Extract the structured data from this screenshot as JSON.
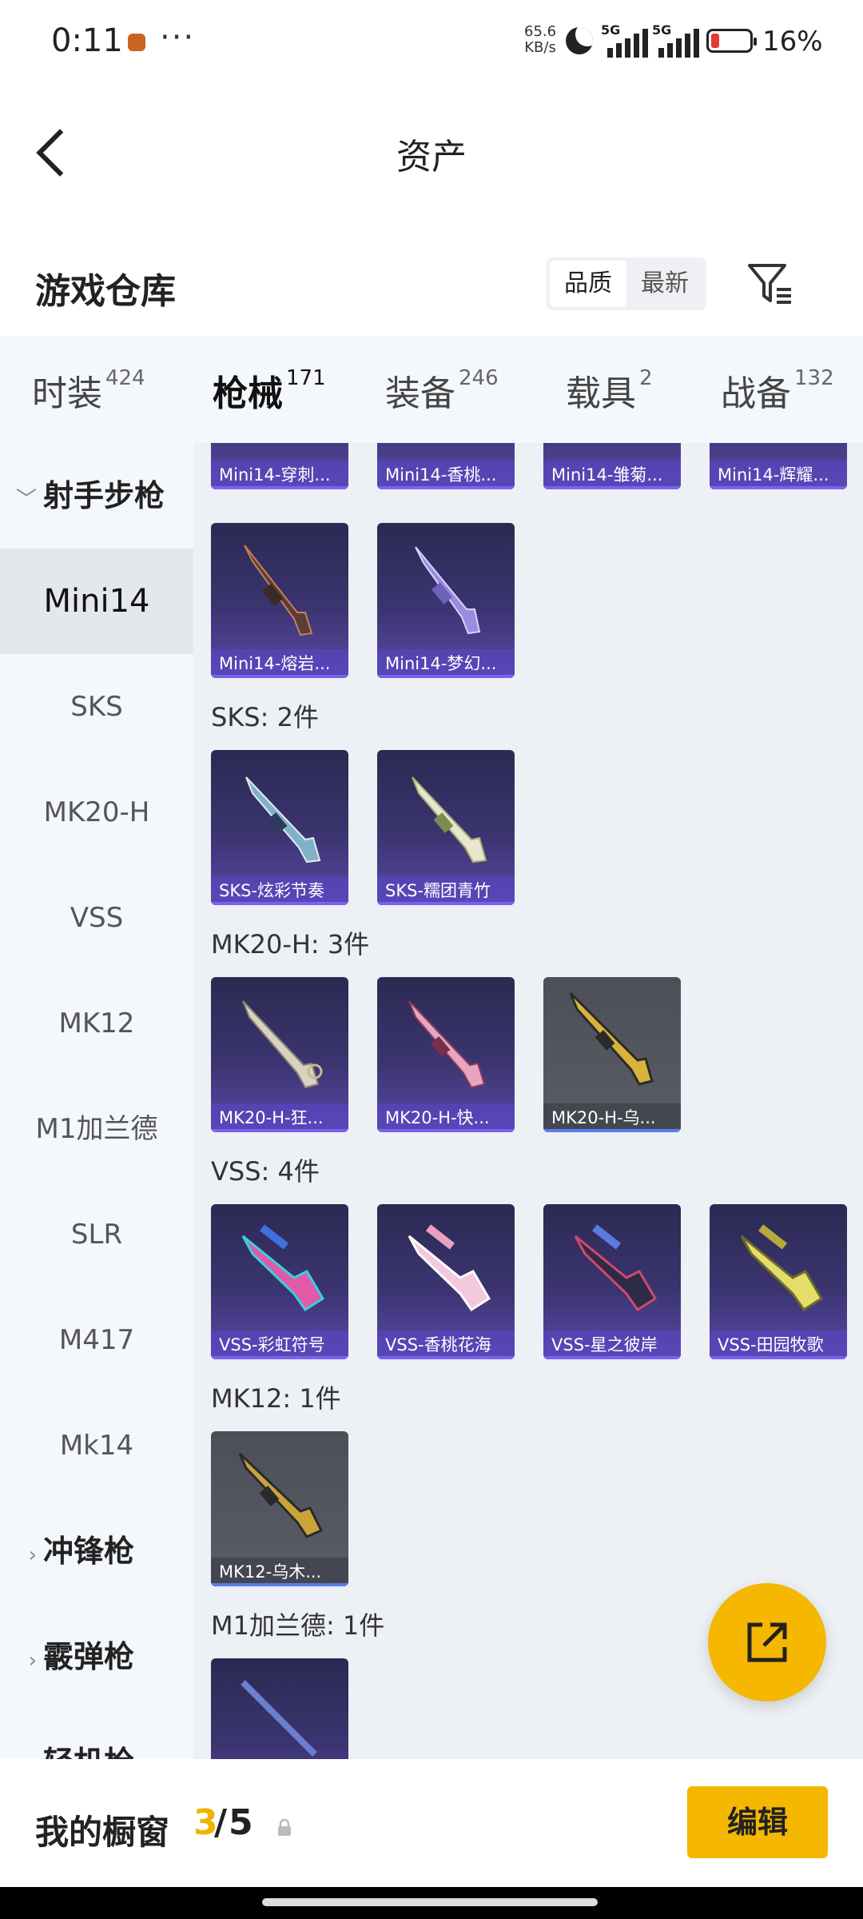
{
  "status": {
    "time": "0:11",
    "net_speed": "65.6",
    "net_unit": "KB/s",
    "sim1": "5G",
    "sim2": "5G",
    "battery": "16%"
  },
  "header": {
    "title": "资产"
  },
  "warehouse": {
    "title": "游戏仓库",
    "sort_quality": "品质",
    "sort_latest": "最新"
  },
  "tabs": [
    {
      "name": "时装",
      "count": "424"
    },
    {
      "name": "枪械",
      "count": "171"
    },
    {
      "name": "装备",
      "count": "246"
    },
    {
      "name": "载具",
      "count": "2"
    },
    {
      "name": "战备",
      "count": "132"
    }
  ],
  "sidebar": {
    "group_open": "射手步枪",
    "items": [
      "Mini14",
      "SKS",
      "MK20-H",
      "VSS",
      "MK12",
      "M1加兰德",
      "SLR",
      "M417",
      "Mk14"
    ],
    "group2": "冲锋枪",
    "group3": "霰弹枪",
    "group4": "轻机枪"
  },
  "sections": {
    "mini14_row1": [
      "Mini14-穿刺...",
      "Mini14-香桃...",
      "Mini14-雏菊...",
      "Mini14-辉耀..."
    ],
    "mini14_row2": [
      "Mini14-熔岩...",
      "Mini14-梦幻..."
    ],
    "sks_title": "SKS: 2件",
    "sks": [
      "SKS-炫彩节奏",
      "SKS-糯团青竹"
    ],
    "mk20_title": "MK20-H: 3件",
    "mk20": [
      "MK20-H-狂...",
      "MK20-H-快...",
      "MK20-H-乌..."
    ],
    "vss_title": "VSS: 4件",
    "vss": [
      "VSS-彩虹符号",
      "VSS-香桃花海",
      "VSS-星之彼岸",
      "VSS-田园牧歌"
    ],
    "mk12_title": "MK12: 1件",
    "mk12": [
      "MK12-乌木..."
    ],
    "m1_title": "M1加兰德: 1件"
  },
  "showcase": {
    "label": "我的橱窗",
    "current": "3",
    "separator": "/",
    "total": "5",
    "edit": "编辑"
  }
}
